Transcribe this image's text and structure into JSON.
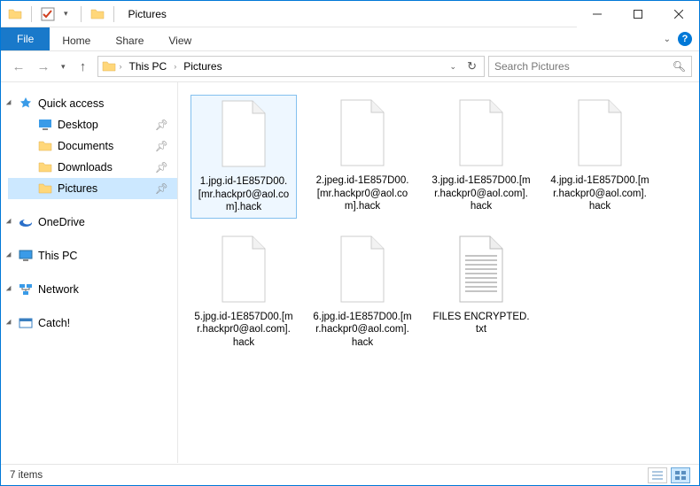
{
  "window": {
    "title": "Pictures"
  },
  "ribbon": {
    "file": "File",
    "tabs": [
      "Home",
      "Share",
      "View"
    ]
  },
  "breadcrumb": {
    "seg1": "This PC",
    "seg2": "Pictures"
  },
  "search": {
    "placeholder": "Search Pictures"
  },
  "nav": {
    "quick": "Quick access",
    "quick_items": [
      {
        "label": "Desktop"
      },
      {
        "label": "Documents"
      },
      {
        "label": "Downloads"
      },
      {
        "label": "Pictures"
      }
    ],
    "onedrive": "OneDrive",
    "thispc": "This PC",
    "network": "Network",
    "catch": "Catch!"
  },
  "files": [
    {
      "name": "1.jpg.id-1E857D00.[mr.hackpr0@aol.com].hack",
      "type": "blank",
      "selected": true
    },
    {
      "name": "2.jpeg.id-1E857D00.[mr.hackpr0@aol.com].hack",
      "type": "blank"
    },
    {
      "name": "3.jpg.id-1E857D00.[mr.hackpr0@aol.com].hack",
      "type": "blank"
    },
    {
      "name": "4.jpg.id-1E857D00.[mr.hackpr0@aol.com].hack",
      "type": "blank"
    },
    {
      "name": "5.jpg.id-1E857D00.[mr.hackpr0@aol.com].hack",
      "type": "blank"
    },
    {
      "name": "6.jpg.id-1E857D00.[mr.hackpr0@aol.com].hack",
      "type": "blank"
    },
    {
      "name": "FILES ENCRYPTED.txt",
      "type": "text"
    }
  ],
  "status": {
    "count": "7 items"
  }
}
